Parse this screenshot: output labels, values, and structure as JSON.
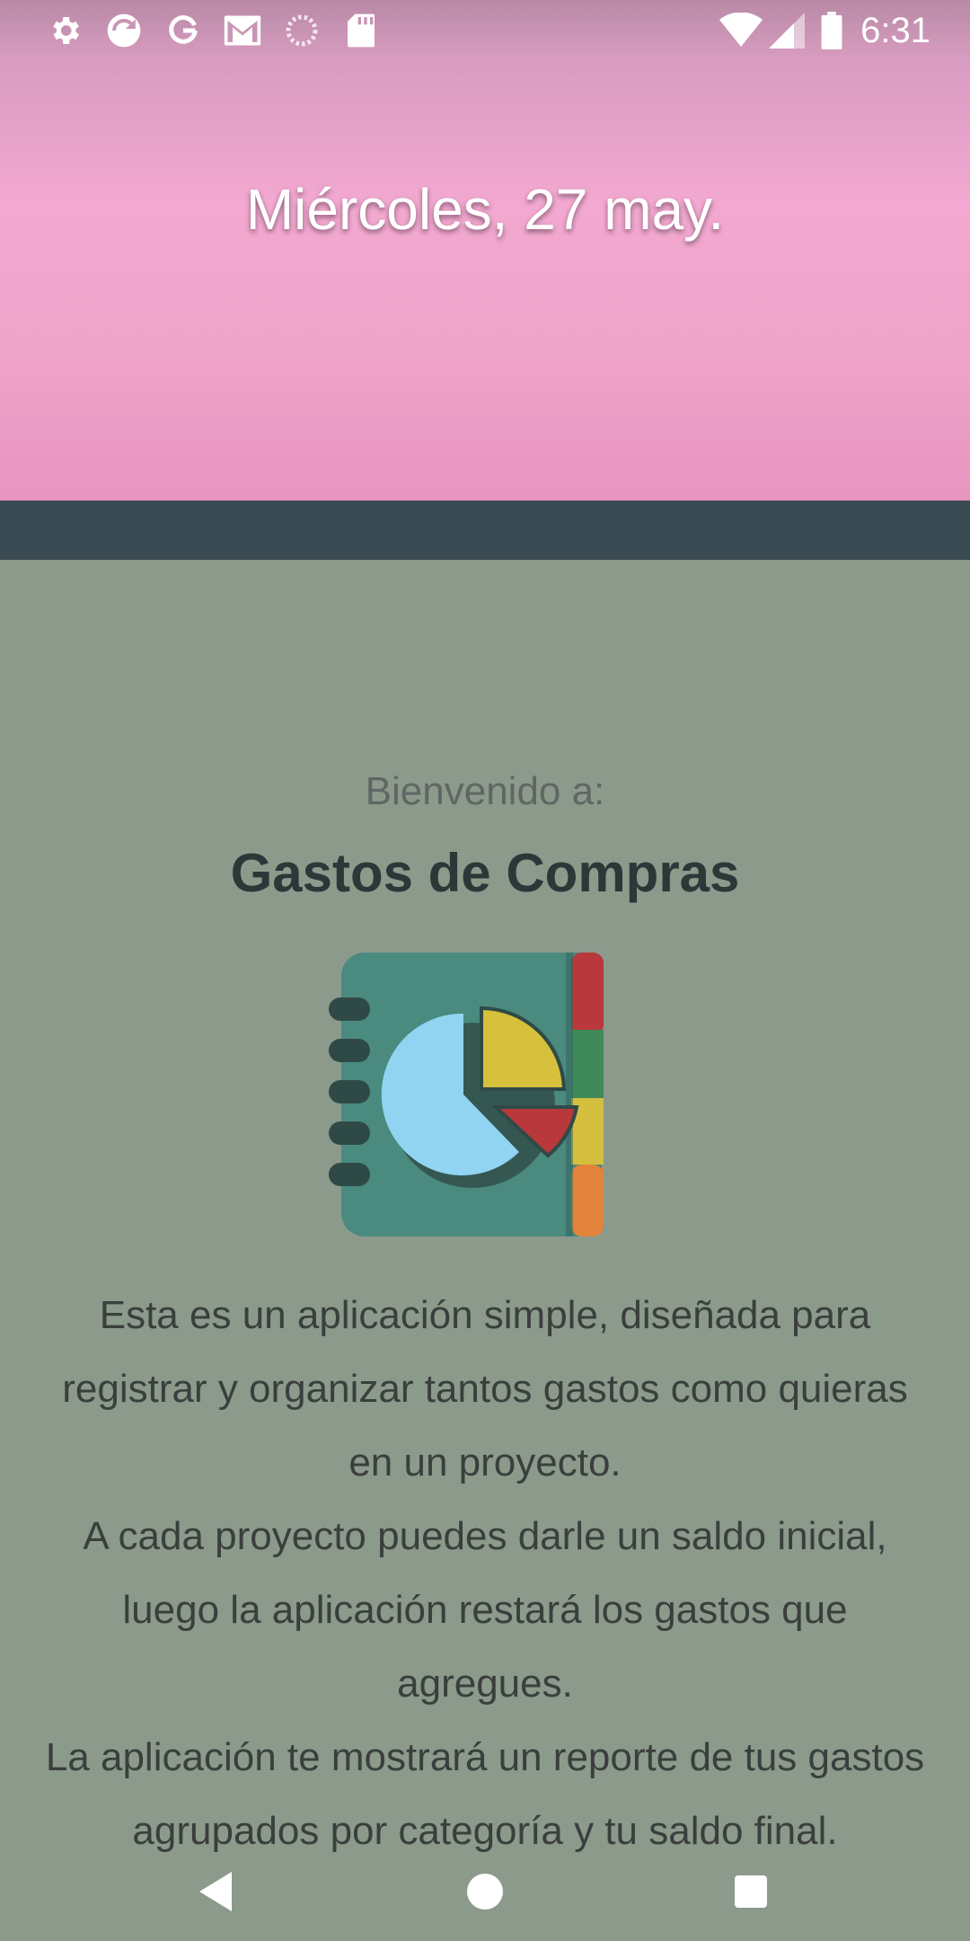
{
  "status_bar": {
    "time": "6:31",
    "icons_left": [
      "gear-icon",
      "sync-icon",
      "google-icon",
      "gmail-icon",
      "loading-icon",
      "sd-card-icon"
    ],
    "icons_right": [
      "wifi-icon",
      "signal-icon",
      "battery-icon"
    ]
  },
  "header": {
    "date": "Miércoles, 27 may."
  },
  "welcome": {
    "subtitle": "Bienvenido a:",
    "app_name": "Gastos de Compras",
    "paragraphs": [
      "Esta es un aplicación simple, diseñada para registrar y organizar tantos gastos como quieras en un proyecto.",
      "A cada proyecto puedes darle un saldo inicial, luego la aplicación restará los gastos que agregues.",
      "La aplicación te mostrará un reporte de tus gastos agrupados por categoría y tu saldo final."
    ]
  },
  "nav": {
    "buttons": [
      "back-icon",
      "home-icon",
      "recents-icon"
    ]
  },
  "colors": {
    "toolbar": "#3a4a52",
    "content_bg": "#8b9a8b",
    "header_pink": "#f2a8d0"
  }
}
